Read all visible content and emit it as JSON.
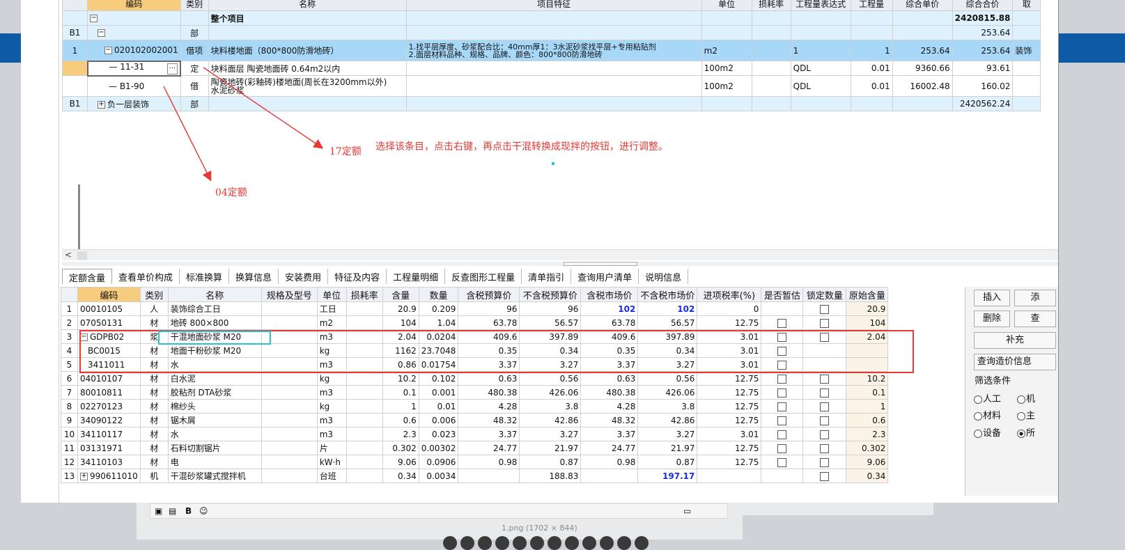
{
  "top_table": {
    "headers": [
      "编码",
      "类别",
      "名称",
      "项目特征",
      "单位",
      "损耗率",
      "工程量表达式",
      "工程量",
      "综合单价",
      "综合合价",
      "取"
    ],
    "rows": [
      {
        "num": "",
        "code": "",
        "type": "",
        "name": "整个项目",
        "feature": "",
        "unit": "",
        "loss": "",
        "expr": "",
        "qty": "",
        "price": "",
        "total": "2420815.88",
        "last": ""
      },
      {
        "num": "B1",
        "code": "",
        "type": "部",
        "name": "",
        "feature": "",
        "unit": "",
        "loss": "",
        "expr": "",
        "qty": "",
        "price": "",
        "total": "253.64",
        "last": ""
      },
      {
        "num": "1",
        "code": "020102002001",
        "type": "借项",
        "name": "块料楼地面（800*800防滑地砖）",
        "feature": "1.找平层厚度、砂浆配合比：40mm厚1：3水泥砂浆找平层+专用粘贴剂 2.面层材料品种、规格、品牌、颜色：800*800防滑地砖",
        "unit": "m2",
        "loss": "",
        "expr": "1",
        "qty": "1",
        "price": "253.64",
        "total": "253.64",
        "last": "装饰"
      },
      {
        "num": "",
        "code": "11-31",
        "type": "定",
        "name": "块料面层 陶瓷地面砖 0.64m2以内",
        "feature": "",
        "unit": "100m2",
        "loss": "",
        "expr": "QDL",
        "qty": "0.01",
        "price": "9360.66",
        "total": "93.61",
        "last": ""
      },
      {
        "num": "",
        "code": "B1-90",
        "type": "借",
        "name": "陶瓷地砖(彩釉砖)楼地面(周长在3200mm以外) 水泥砂浆",
        "feature": "",
        "unit": "100m2",
        "loss": "",
        "expr": "QDL",
        "qty": "0.01",
        "price": "16002.48",
        "total": "160.02",
        "last": ""
      },
      {
        "num": "B1",
        "code": "",
        "type": "部",
        "name": "负一层装饰",
        "feature": "",
        "unit": "",
        "loss": "",
        "expr": "",
        "qty": "",
        "price": "",
        "total": "2420562.24",
        "last": ""
      }
    ],
    "feature_line1": "1.找平层厚度、砂浆配合比：40mm厚1：3水泥砂浆找平层+专用粘贴剂",
    "feature_line2": "2.面层材料品种、规格、品牌、颜色：800*800防滑地砖",
    "name_line1": "陶瓷地砖(彩釉砖)楼地面(周长在3200mm以外)",
    "name_line2": "水泥砂浆"
  },
  "annotations": {
    "label17": "17定额",
    "label04": "04定额",
    "instruction": "选择该条目，点击右键，再点击干混转换成现拌的按钮，进行调整。"
  },
  "tabs": [
    "定额含量",
    "查看单价构成",
    "标准换算",
    "换算信息",
    "安装费用",
    "特征及内容",
    "工程量明细",
    "反查图形工程量",
    "清单指引",
    "查询用户清单",
    "说明信息"
  ],
  "bottom_table": {
    "headers": [
      "编码",
      "类别",
      "名称",
      "规格及型号",
      "单位",
      "损耗率",
      "含量",
      "数量",
      "含税预算价",
      "不含税预算价",
      "含税市场价",
      "不含税市场价",
      "进项税率(%)",
      "是否暂估",
      "锁定数量",
      "原始含量"
    ],
    "rows": [
      {
        "n": "1",
        "code": "00010105",
        "type": "人",
        "name": "装饰综合工日",
        "unit": "工日",
        "hl": "20.9",
        "sl": "0.209",
        "a": "96",
        "b": "96",
        "c": "102",
        "d": "102",
        "tax": "0",
        "orig": "20.9"
      },
      {
        "n": "2",
        "code": "07050131",
        "type": "材",
        "name": "地砖 800×800",
        "unit": "m2",
        "hl": "104",
        "sl": "1.04",
        "a": "63.78",
        "b": "56.57",
        "c": "63.78",
        "d": "56.57",
        "tax": "12.75",
        "orig": "104"
      },
      {
        "n": "3",
        "code": "GDPB02",
        "type": "浆",
        "name": "干混地面砂浆 M20",
        "unit": "m3",
        "hl": "2.04",
        "sl": "0.0204",
        "a": "409.6",
        "b": "397.89",
        "c": "409.6",
        "d": "397.89",
        "tax": "3.01",
        "orig": "2.04"
      },
      {
        "n": "4",
        "code": "BC0015",
        "type": "材",
        "name": "地面干粉砂浆 M20",
        "unit": "kg",
        "hl": "1162",
        "sl": "23.7048",
        "a": "0.35",
        "b": "0.34",
        "c": "0.35",
        "d": "0.34",
        "tax": "3.01",
        "orig": ""
      },
      {
        "n": "5",
        "code": "3411011",
        "type": "材",
        "name": "水",
        "unit": "m3",
        "hl": "0.86",
        "sl": "0.01754",
        "a": "3.37",
        "b": "3.27",
        "c": "3.37",
        "d": "3.27",
        "tax": "3.01",
        "orig": ""
      },
      {
        "n": "6",
        "code": "04010107",
        "type": "材",
        "name": "白水泥",
        "unit": "kg",
        "hl": "10.2",
        "sl": "0.102",
        "a": "0.63",
        "b": "0.56",
        "c": "0.63",
        "d": "0.56",
        "tax": "12.75",
        "orig": "10.2"
      },
      {
        "n": "7",
        "code": "80010811",
        "type": "材",
        "name": "胶粘剂 DTA砂浆",
        "unit": "m3",
        "hl": "0.1",
        "sl": "0.001",
        "a": "480.38",
        "b": "426.06",
        "c": "480.38",
        "d": "426.06",
        "tax": "12.75",
        "orig": "0.1"
      },
      {
        "n": "8",
        "code": "02270123",
        "type": "材",
        "name": "棉纱头",
        "unit": "kg",
        "hl": "1",
        "sl": "0.01",
        "a": "4.28",
        "b": "3.8",
        "c": "4.28",
        "d": "3.8",
        "tax": "12.75",
        "orig": "1"
      },
      {
        "n": "9",
        "code": "34090122",
        "type": "材",
        "name": "锯木屑",
        "unit": "m3",
        "hl": "0.6",
        "sl": "0.006",
        "a": "48.32",
        "b": "42.86",
        "c": "48.32",
        "d": "42.86",
        "tax": "12.75",
        "orig": "0.6"
      },
      {
        "n": "10",
        "code": "34110117",
        "type": "材",
        "name": "水",
        "unit": "m3",
        "hl": "2.3",
        "sl": "0.023",
        "a": "3.37",
        "b": "3.27",
        "c": "3.37",
        "d": "3.27",
        "tax": "3.01",
        "orig": "2.3"
      },
      {
        "n": "11",
        "code": "03131971",
        "type": "材",
        "name": "石料切割锯片",
        "unit": "片",
        "hl": "0.302",
        "sl": "0.00302",
        "a": "24.77",
        "b": "21.97",
        "c": "24.77",
        "d": "21.97",
        "tax": "12.75",
        "orig": "0.302"
      },
      {
        "n": "12",
        "code": "34110103",
        "type": "材",
        "name": "电",
        "unit": "kW·h",
        "hl": "9.06",
        "sl": "0.0906",
        "a": "0.98",
        "b": "0.87",
        "c": "0.98",
        "d": "0.87",
        "tax": "12.75",
        "orig": "9.06"
      },
      {
        "n": "13",
        "code": "990611010",
        "type": "机",
        "name": "干混砂浆罐式搅拌机",
        "unit": "台班",
        "hl": "0.34",
        "sl": "0.0034",
        "a": "",
        "b": "188.83",
        "c": "",
        "d": "197.17",
        "tax": "",
        "orig": "0.34"
      }
    ]
  },
  "right_pane": {
    "insert": "插入",
    "add": "添",
    "delete": "删除",
    "query": "查",
    "supplement": "补充",
    "query_price": "查询造价信息",
    "filter_title": "筛选条件",
    "opt_labor": "人工",
    "opt_machine": "机",
    "opt_material": "材料",
    "opt_main": "主",
    "opt_equip": "设备",
    "opt_all": "所"
  },
  "background": {
    "image_caption": "1.png (1702 × 844)",
    "bold_b": "B"
  }
}
